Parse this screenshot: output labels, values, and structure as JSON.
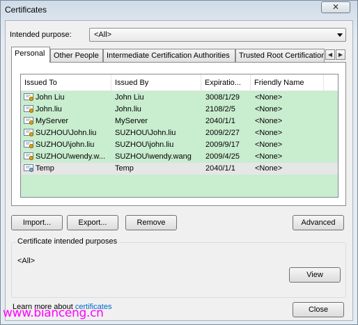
{
  "window": {
    "title": "Certificates",
    "close_glyph": "✕"
  },
  "purpose": {
    "label": "Intended purpose:",
    "value": "<All>",
    "icon": "chevron-down-icon"
  },
  "tabs": [
    {
      "label": "Personal",
      "active": true
    },
    {
      "label": "Other People"
    },
    {
      "label": "Intermediate Certification Authorities"
    },
    {
      "label": "Trusted Root Certification"
    }
  ],
  "tab_scroll": {
    "left": "◀",
    "right": "▶"
  },
  "list": {
    "columns": [
      "Issued To",
      "Issued By",
      "Expiratio...",
      "Friendly Name"
    ],
    "rows": [
      {
        "issued_to": "John Liu",
        "issued_by": "John Liu",
        "expiration": "3008/1/29",
        "friendly": "<None>"
      },
      {
        "issued_to": "John.liu",
        "issued_by": "John.liu",
        "expiration": "2108/2/5",
        "friendly": "<None>"
      },
      {
        "issued_to": "MyServer",
        "issued_by": "MyServer",
        "expiration": "2040/1/1",
        "friendly": "<None>"
      },
      {
        "issued_to": "SUZHOU\\John.liu",
        "issued_by": "SUZHOU\\John.liu",
        "expiration": "2009/2/27",
        "friendly": "<None>"
      },
      {
        "issued_to": "SUZHOU\\john.liu",
        "issued_by": "SUZHOU\\john.liu",
        "expiration": "2009/9/17",
        "friendly": "<None>"
      },
      {
        "issued_to": "SUZHOU\\wendy.w...",
        "issued_by": "SUZHOU\\wendy.wang",
        "expiration": "2009/4/25",
        "friendly": "<None>"
      },
      {
        "issued_to": "Temp",
        "issued_by": "Temp",
        "expiration": "2040/1/1",
        "friendly": "<None>",
        "selected": true
      }
    ],
    "list_color": "#c9edcf"
  },
  "buttons": {
    "import": "Import...",
    "export": "Export...",
    "remove": "Remove",
    "advanced": "Advanced",
    "view": "View",
    "close": "Close"
  },
  "purposes_group": {
    "title": "Certificate intended purposes",
    "value": "<All>"
  },
  "learn_more": {
    "prefix": "Learn more about ",
    "link": "certificates"
  },
  "watermark": "www.bianceng.cn"
}
